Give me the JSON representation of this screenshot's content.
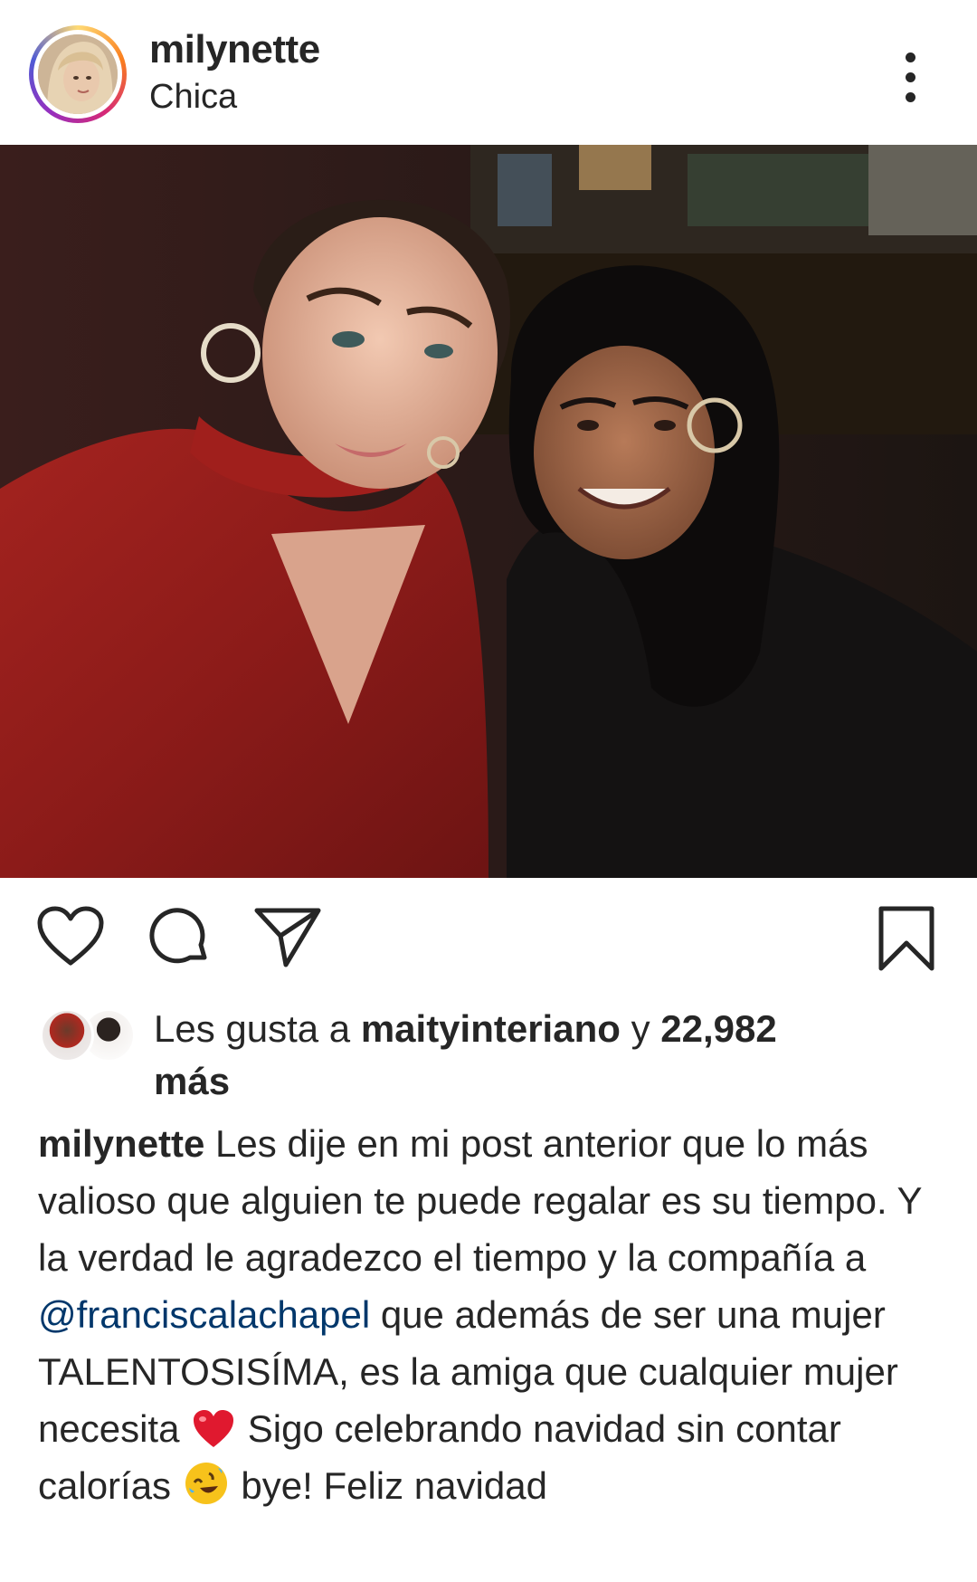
{
  "header": {
    "username": "milynette",
    "location": "Chica",
    "more_icon": "more-vertical-icon"
  },
  "post_image": {
    "description_icon": "photo"
  },
  "actions": {
    "like_icon": "heart-icon",
    "comment_icon": "comment-icon",
    "share_icon": "send-icon",
    "save_icon": "bookmark-icon"
  },
  "likes": {
    "prefix": "Les gusta a ",
    "user": "maityinteriano",
    "middle": " y ",
    "count": "22,982",
    "suffix": "más"
  },
  "caption": {
    "username": "milynette",
    "text_part1": " Les dije en mi post anterior que lo más valioso que alguien te puede regalar es su tiempo. Y la verdad le agradezco el tiempo y la compañía a ",
    "mention": "@franciscalachapel",
    "text_part2": " que además de ser una mujer TALENTOSISÍMA, es la amiga que cualquier mujer necesita ",
    "text_part3": " Sigo celebrando navidad sin contar calorías ",
    "text_part4": " bye! Feliz navidad",
    "emoji_heart": "red-heart-emoji",
    "emoji_laugh": "rolling-laughing-emoji"
  },
  "colors": {
    "text": "#262626",
    "mention": "#00376b",
    "background": "#ffffff"
  }
}
